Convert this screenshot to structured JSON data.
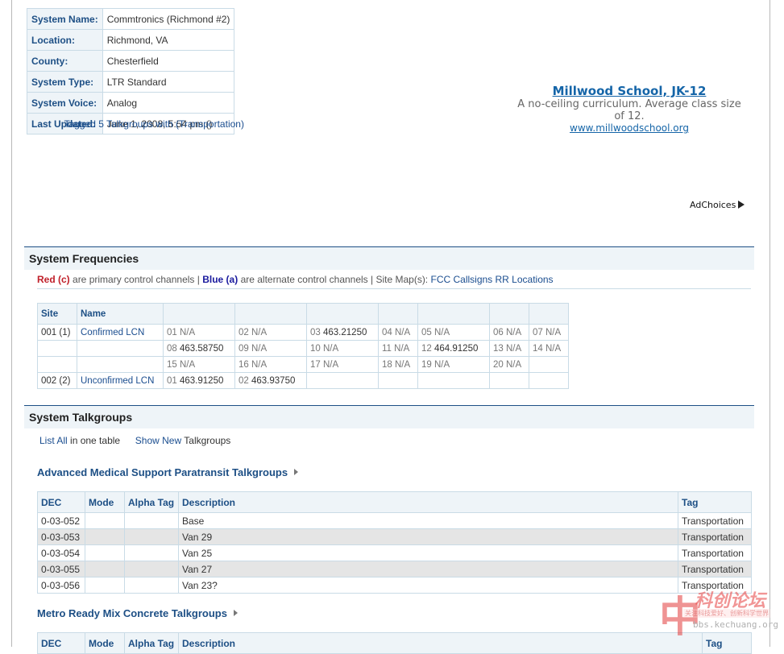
{
  "system_info": [
    {
      "label": "System Name:",
      "value": "Commtronics (Richmond #2)"
    },
    {
      "label": "Location:",
      "value": "Richmond, VA"
    },
    {
      "label": "County:",
      "value": "Chesterfield"
    },
    {
      "label": "System Type:",
      "value": "LTR Standard"
    },
    {
      "label": "System Voice:",
      "value": "Analog"
    },
    {
      "label": "Last Updated:",
      "value": "June 1, 2008, 5:54 pm (",
      "link": "Tagged 5 Talkgroups with (Transportation)",
      "suffix": ")"
    }
  ],
  "ad": {
    "title": "Millwood School, JK-12",
    "desc": "A no-ceiling curriculum. Average class size of 12.",
    "url": "www.millwoodschool.org",
    "adchoices": "AdChoices"
  },
  "frequencies": {
    "heading": "System Frequencies",
    "legend_red": "Red (c)",
    "legend_mid1": "are primary control channels |",
    "legend_blue": "Blue (a)",
    "legend_mid2": "are alternate control channels | Site Map(s):",
    "legend_links": "FCC Callsigns RR Locations",
    "col_site": "Site",
    "col_name": "Name",
    "rows": [
      {
        "site": "001 (1)",
        "name": "Confirmed LCN",
        "cells": [
          [
            "01 N/A",
            ""
          ],
          [
            "02 N/A",
            ""
          ],
          [
            "03 ",
            "463.21250"
          ],
          [
            "04 N/A",
            ""
          ],
          [
            "05 N/A",
            ""
          ],
          [
            "06 N/A",
            ""
          ],
          [
            "07 N/A",
            ""
          ]
        ]
      },
      {
        "site": "",
        "name": "",
        "cells": [
          [
            "08 ",
            "463.58750"
          ],
          [
            "09 N/A",
            ""
          ],
          [
            "10 N/A",
            ""
          ],
          [
            "11 N/A",
            ""
          ],
          [
            "12 ",
            "464.91250"
          ],
          [
            "13 N/A",
            ""
          ],
          [
            "14 N/A",
            ""
          ]
        ]
      },
      {
        "site": "",
        "name": "",
        "cells": [
          [
            "15 N/A",
            ""
          ],
          [
            "16 N/A",
            ""
          ],
          [
            "17 N/A",
            ""
          ],
          [
            "18 N/A",
            ""
          ],
          [
            "19 N/A",
            ""
          ],
          [
            "20 N/A",
            ""
          ],
          [
            "",
            ""
          ]
        ]
      },
      {
        "site": "002 (2)",
        "name": "Unconfirmed LCN",
        "cells": [
          [
            "01 ",
            "463.91250"
          ],
          [
            "02 ",
            "463.93750"
          ],
          [
            "",
            ""
          ],
          [
            "",
            ""
          ],
          [
            "",
            ""
          ],
          [
            "",
            ""
          ],
          [
            "",
            ""
          ]
        ]
      }
    ]
  },
  "talkgroups": {
    "heading": "System Talkgroups",
    "list_all": "List All",
    "in_one_table": "in one table",
    "show_new": "Show New",
    "talkgroups_word": "Talkgroups",
    "columns": [
      "DEC",
      "Mode",
      "Alpha Tag",
      "Description",
      "Tag"
    ],
    "groups": [
      {
        "title": "Advanced Medical Support Paratransit Talkgroups",
        "rows": [
          {
            "dec": "0-03-052",
            "mode": "",
            "alpha": "",
            "desc": "Base",
            "tag": "Transportation"
          },
          {
            "dec": "0-03-053",
            "mode": "",
            "alpha": "",
            "desc": "Van 29",
            "tag": "Transportation"
          },
          {
            "dec": "0-03-054",
            "mode": "",
            "alpha": "",
            "desc": "Van 25",
            "tag": "Transportation"
          },
          {
            "dec": "0-03-055",
            "mode": "",
            "alpha": "",
            "desc": "Van 27",
            "tag": "Transportation"
          },
          {
            "dec": "0-03-056",
            "mode": "",
            "alpha": "",
            "desc": "Van 23?",
            "tag": "Transportation"
          }
        ]
      },
      {
        "title": "Metro Ready Mix Concrete Talkgroups",
        "rows": []
      }
    ]
  },
  "watermark": {
    "big": "中",
    "title": "科创论坛",
    "tagline": "关注科技爱好、创新科学世界",
    "url": "bbs.kechuang.org"
  }
}
